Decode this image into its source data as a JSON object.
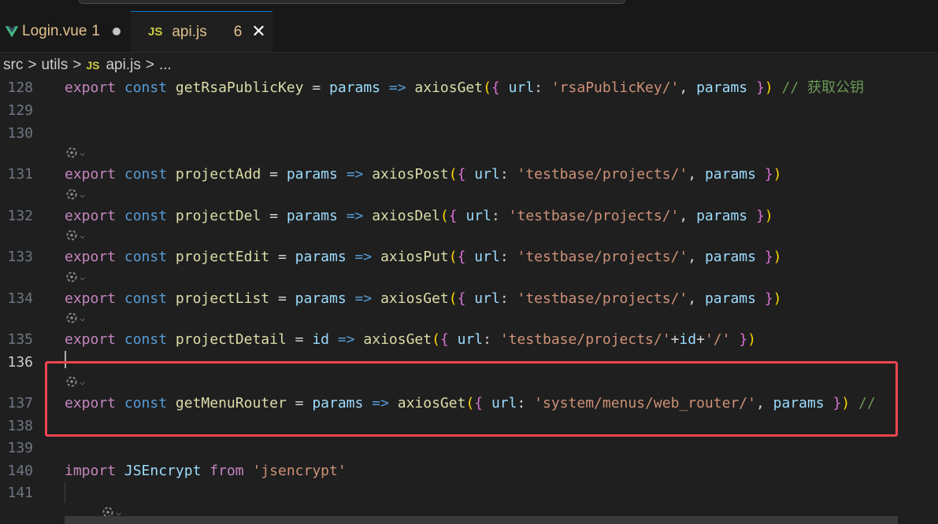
{
  "tabs": [
    {
      "name": "Login.vue",
      "badge": "1",
      "modified": true,
      "icon": "vue-icon",
      "active": false
    },
    {
      "name": "api.js",
      "badge": "6",
      "icon": "js-icon",
      "icon_text": "JS",
      "active": true,
      "close": "✕"
    }
  ],
  "breadcrumb": {
    "items": [
      "src",
      "utils",
      "api.js",
      "..."
    ],
    "separator": ">",
    "js_icon_text": "JS"
  },
  "codelens_icon": "copilot-icon",
  "lines": [
    {
      "n": "128",
      "tokens": "export const getRsaPublicKey = params => axiosGet({ url: 'rsaPublicKey/', params }) // 获取公钥"
    },
    {
      "n": "129",
      "tokens": ""
    },
    {
      "n": "130",
      "tokens": ""
    },
    {
      "n": "131",
      "tokens": "export const projectAdd = params => axiosPost({ url: 'testbase/projects/', params })"
    },
    {
      "n": "132",
      "tokens": "export const projectDel = params => axiosDel({ url: 'testbase/projects/', params })"
    },
    {
      "n": "133",
      "tokens": "export const projectEdit = params => axiosPut({ url: 'testbase/projects/', params })"
    },
    {
      "n": "134",
      "tokens": "export const projectList = params => axiosGet({ url: 'testbase/projects/', params })"
    },
    {
      "n": "135",
      "tokens": "export const projectDetail = id => axiosGet({ url: 'testbase/projects/'+id+'/' })"
    },
    {
      "n": "136",
      "tokens": ""
    },
    {
      "n": "137",
      "tokens": "export const getMenuRouter = params => axiosGet({ url: 'system/menus/web_router/', params }) //"
    },
    {
      "n": "138",
      "tokens": ""
    },
    {
      "n": "139",
      "tokens": ""
    },
    {
      "n": "140",
      "tokens": "import JSEncrypt from 'jsencrypt'"
    },
    {
      "n": "141",
      "tokens": ""
    }
  ],
  "colors": {
    "keyword": "#c586c0",
    "storage": "#569cd6",
    "function": "#dcdcaa",
    "variable": "#9cdcfe",
    "string": "#ce9178",
    "comment": "#6a9955",
    "highlight_box": "#f0454f",
    "modified_file": "#e2c08d"
  }
}
